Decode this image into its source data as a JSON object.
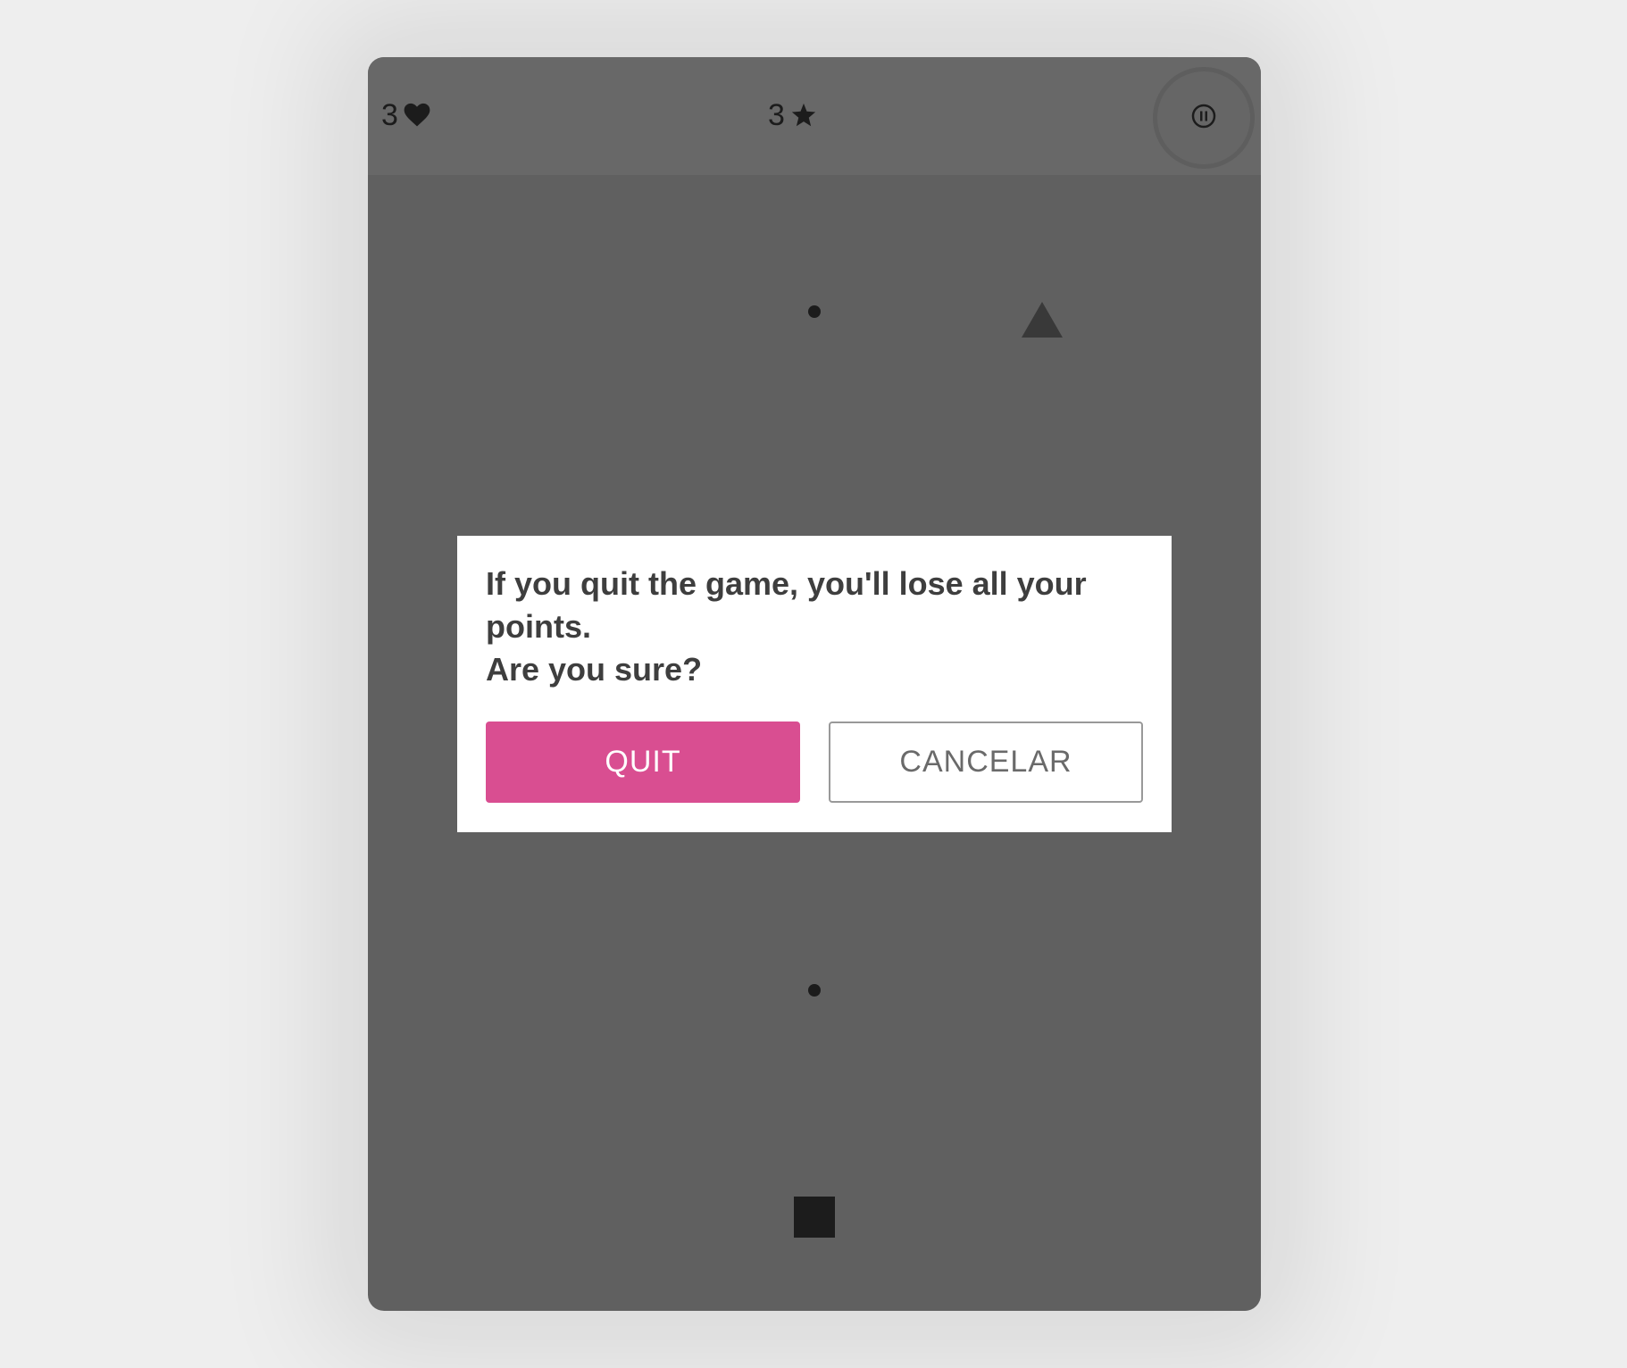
{
  "hud": {
    "lives": "3",
    "lives_icon": "heart-icon",
    "stars": "3",
    "stars_icon": "star-icon",
    "pause_icon": "pause-icon"
  },
  "playfield": {
    "shapes": [
      "dot",
      "triangle",
      "dot",
      "square"
    ]
  },
  "dialog": {
    "message_line1": "If you quit the game, you'll lose all your points.",
    "message_line2": "Are you sure?",
    "quit_label": "QUIT",
    "cancel_label": "CANCELAR"
  },
  "colors": {
    "accent": "#d94e91",
    "overlay": "#606060",
    "hud_background": "#686868",
    "page_background": "#eeeeee"
  }
}
